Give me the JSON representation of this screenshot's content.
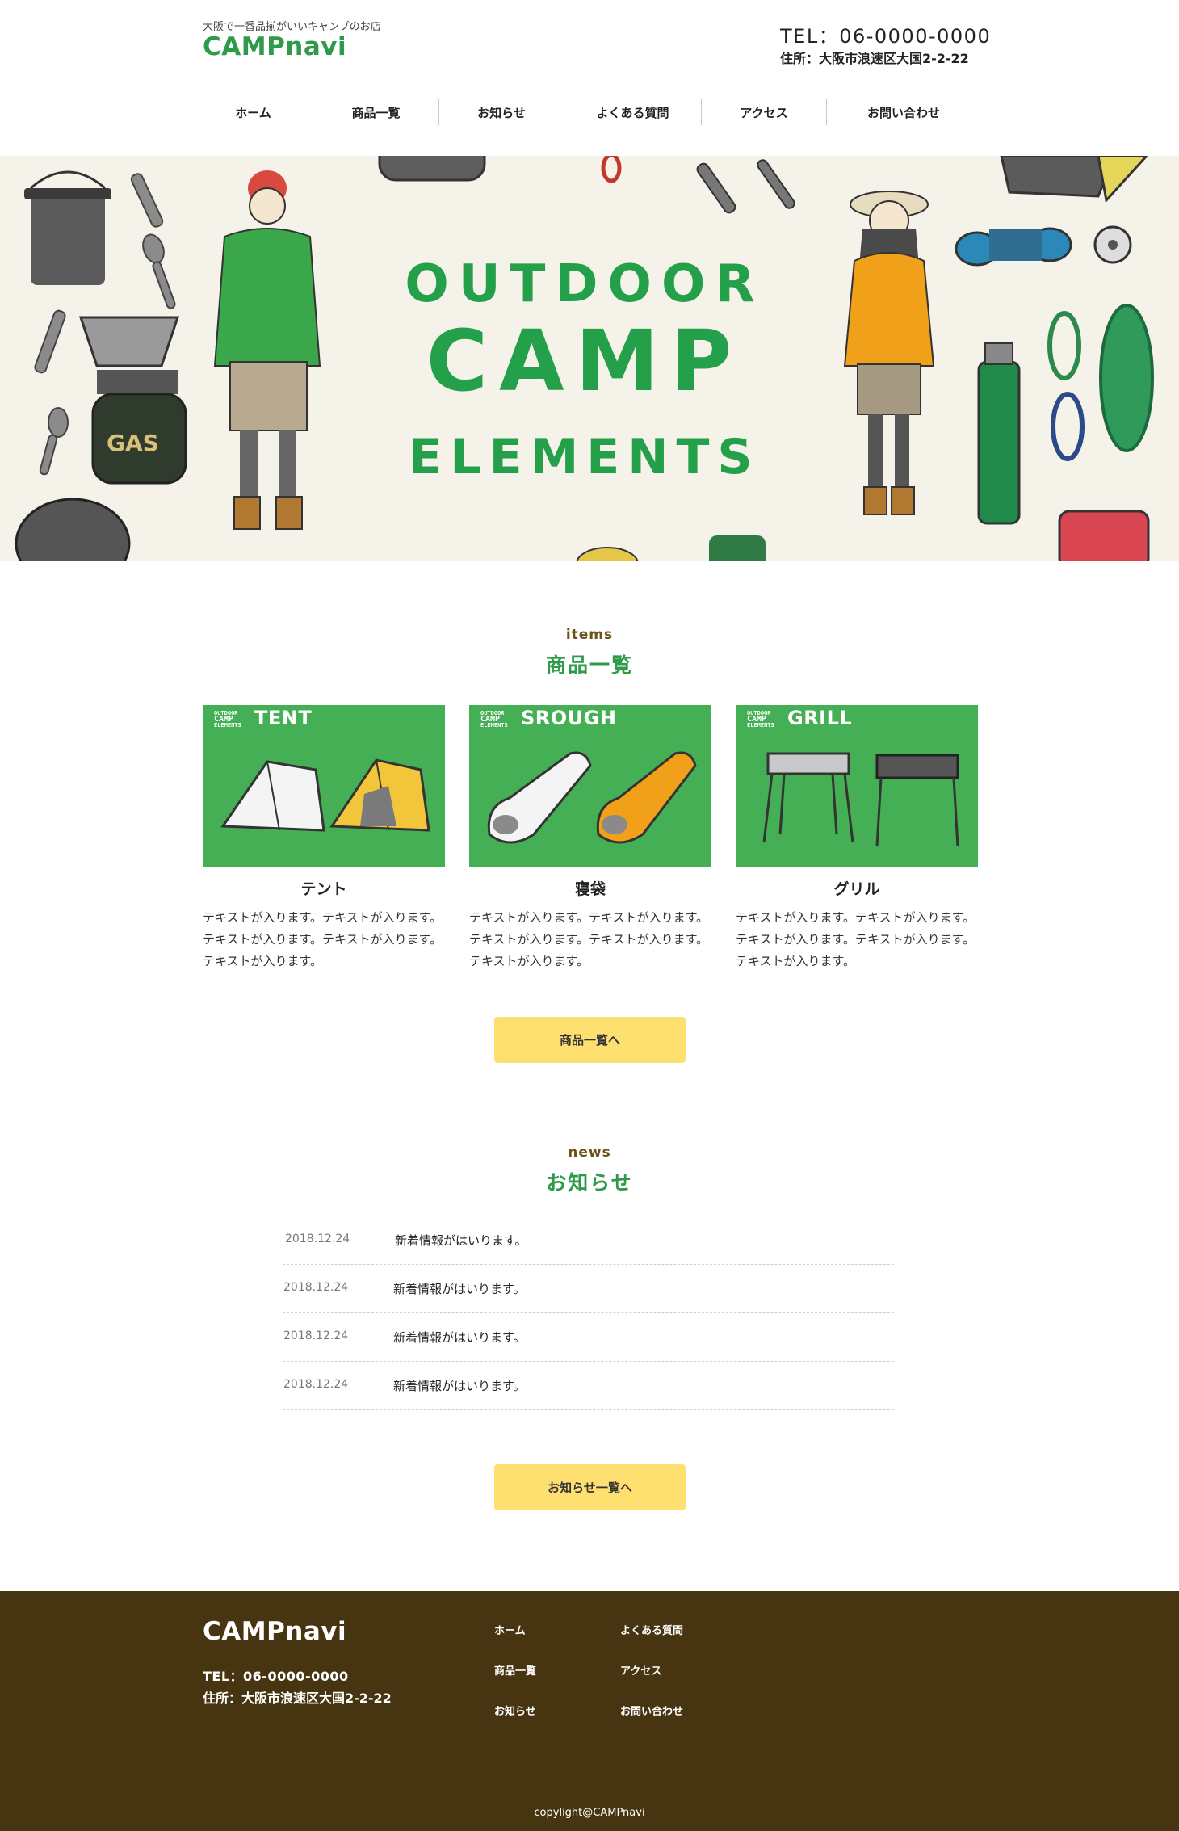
{
  "header": {
    "tagline": "大阪で一番品揃がいいキャンプのお店",
    "logo": "CAMPnavi",
    "tel": "TEL：06-0000-0000",
    "address": "住所：大阪市浪速区大国2-2-22"
  },
  "nav": [
    {
      "label": "ホーム"
    },
    {
      "label": "商品一覧"
    },
    {
      "label": "お知らせ"
    },
    {
      "label": "よくある質問"
    },
    {
      "label": "アクセス"
    },
    {
      "label": "お問い合わせ"
    }
  ],
  "hero": {
    "line1": "OUTDOOR",
    "line2": "CAMP",
    "line3": "ELEMENTS",
    "gas_label": "GAS"
  },
  "items_section": {
    "sub": "items",
    "title": "商品一覧",
    "button": "商品一覧へ",
    "card_brand": [
      "OUTDOOR",
      "CAMP",
      "ELEMENTS"
    ],
    "items": [
      {
        "banner": "TENT",
        "name": "テント",
        "text": "テキストが入ります。テキストが入ります。テキストが入ります。テキストが入ります。テキストが入ります。"
      },
      {
        "banner": "SROUGH",
        "name": "寝袋",
        "text": "テキストが入ります。テキストが入ります。テキストが入ります。テキストが入ります。テキストが入ります。"
      },
      {
        "banner": "GRILL",
        "name": "グリル",
        "text": "テキストが入ります。テキストが入ります。テキストが入ります。テキストが入ります。テキストが入ります。"
      }
    ]
  },
  "news_section": {
    "sub": "news",
    "title": "お知らせ",
    "button": "お知らせ一覧へ",
    "items": [
      {
        "date": "2018.12.24",
        "title": "新着情報がはいります。"
      },
      {
        "date": "2018.12.24",
        "title": "新着情報がはいります。"
      },
      {
        "date": "2018.12.24",
        "title": "新着情報がはいります。"
      },
      {
        "date": "2018.12.24",
        "title": "新着情報がはいります。"
      }
    ]
  },
  "footer": {
    "logo": "CAMPnavi",
    "tel": "TEL：06-0000-0000",
    "address": "住所：大阪市浪速区大国2-2-22",
    "links": [
      {
        "label": "ホーム"
      },
      {
        "label": "商品一覧"
      },
      {
        "label": "お知らせ"
      },
      {
        "label": "よくある質問"
      },
      {
        "label": "アクセス"
      },
      {
        "label": "お問い合わせ"
      }
    ],
    "copyright": "copylight@CAMPnavi"
  },
  "colors": {
    "brand_green": "#2e9a4a",
    "card_green": "#44af55",
    "button_yellow": "#fee071",
    "footer_brown": "#473512",
    "subheading_brown": "#6b5217"
  }
}
